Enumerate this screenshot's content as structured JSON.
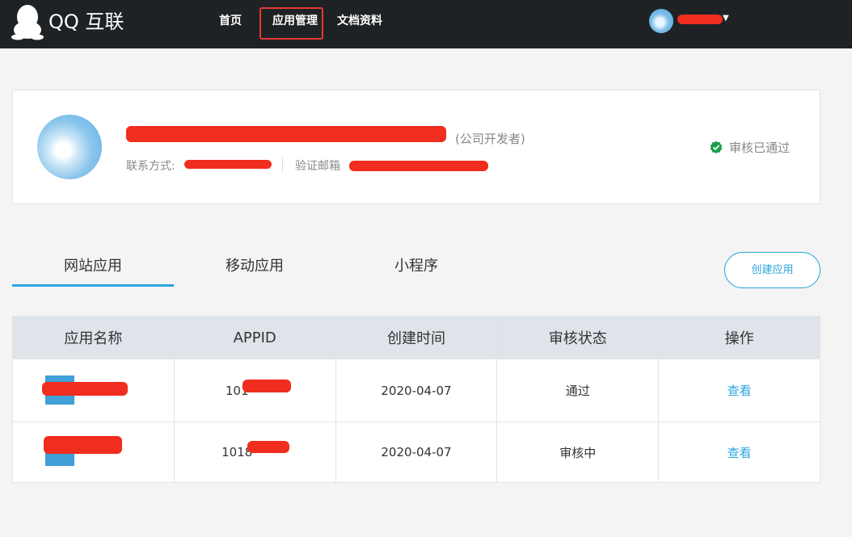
{
  "topbar": {
    "brand": "QQ 互联",
    "nav": [
      "首页",
      "应用管理",
      "文档资料"
    ]
  },
  "profile": {
    "developer_type": "(公司开发者)",
    "contact_label": "联系方式:",
    "email_label": "验证邮箱",
    "status": "审核已通过"
  },
  "tabs": [
    "网站应用",
    "移动应用",
    "小程序"
  ],
  "create_button": "创建应用",
  "table": {
    "headers": [
      "应用名称",
      "APPID",
      "创建时间",
      "审核状态",
      "操作"
    ],
    "rows": [
      {
        "appid_prefix": "101",
        "created": "2020-04-07",
        "status": "通过",
        "action": "查看"
      },
      {
        "appid_prefix": "1018",
        "created": "2020-04-07",
        "status": "审核中",
        "action": "查看"
      }
    ]
  },
  "colors": {
    "topbar": "#1f2225",
    "accent": "#2aa5dc",
    "approved": "#1aa048",
    "pending": "#f0703a",
    "redaction": "#f02d1e"
  }
}
